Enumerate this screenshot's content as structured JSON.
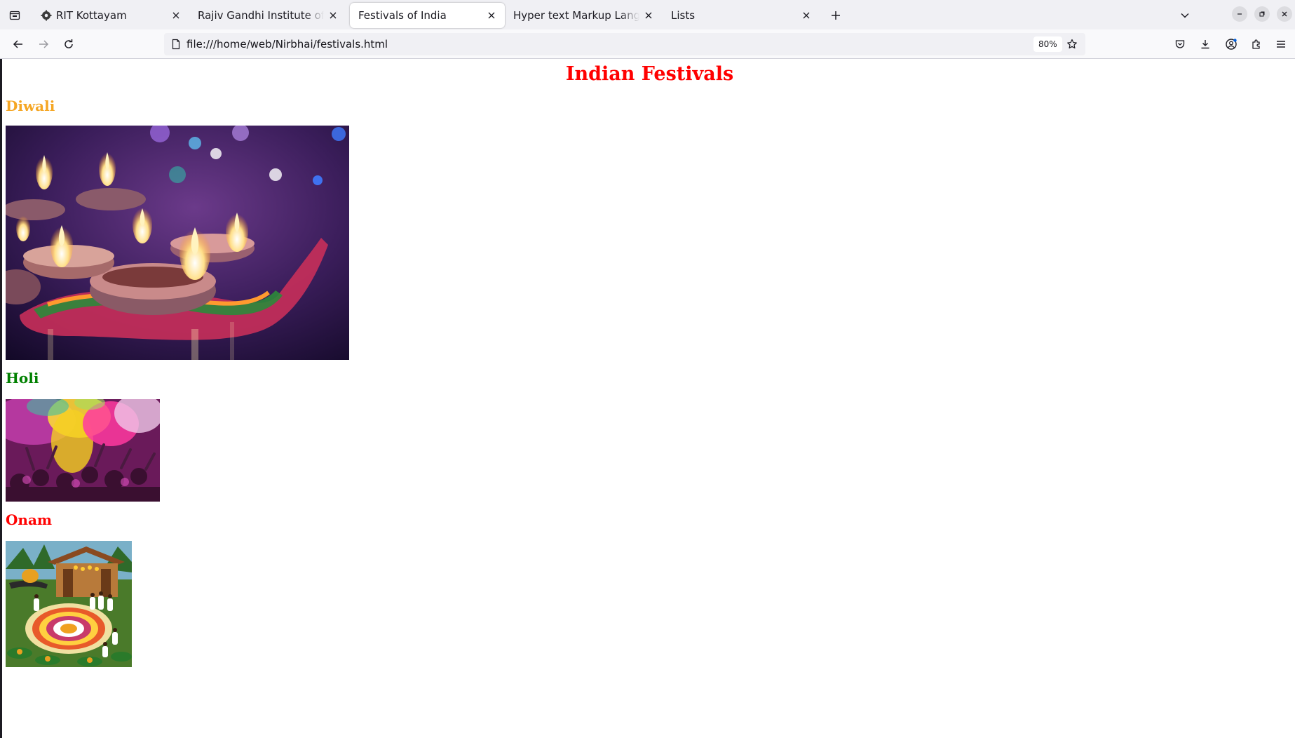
{
  "browser": {
    "tabs": [
      {
        "title": "RIT Kottayam",
        "active": false,
        "favicon": "gear-favicon"
      },
      {
        "title": "Rajiv Gandhi Institute of Technology",
        "active": false
      },
      {
        "title": "Festivals of India",
        "active": true
      },
      {
        "title": "Hyper text Markup Language",
        "active": false
      },
      {
        "title": "Lists",
        "active": false
      }
    ],
    "url": "file:///home/web/Nirbhai/festivals.html",
    "zoom": "80%"
  },
  "page": {
    "title": "Indian Festivals",
    "title_color": "#ff0000",
    "sections": [
      {
        "heading": "Diwali",
        "color": "#f5a623",
        "image": "diwali-lamps-photo"
      },
      {
        "heading": "Holi",
        "color": "#008000",
        "image": "holi-colors-photo"
      },
      {
        "heading": "Onam",
        "color": "#ff0000",
        "image": "onam-pookalam-illustration"
      }
    ]
  },
  "colors": {
    "tabbar_bg": "#f0f0f4",
    "toolbar_bg": "#f9f9fb",
    "text": "#1c1b22"
  }
}
